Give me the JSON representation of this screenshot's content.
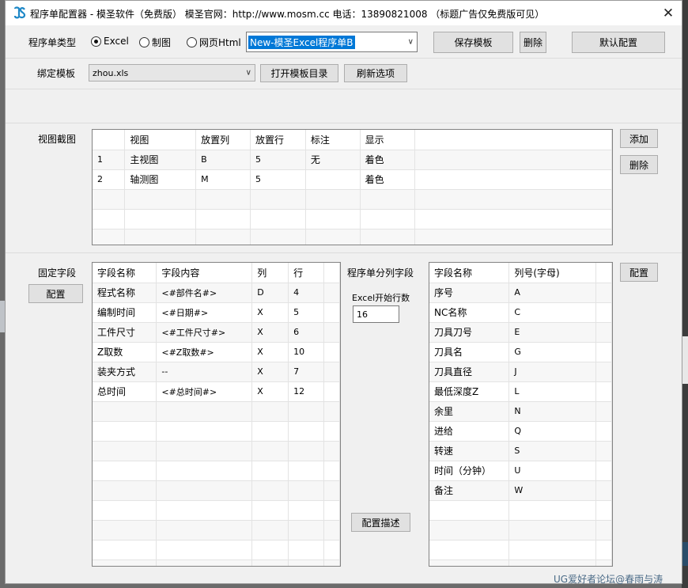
{
  "window": {
    "title": "程序单配置器 - 模圣软件（免费版） 模圣官网：http://www.mosm.cc 电话：13890821008 （标题广告仅免费版可见）",
    "close_glyph": "✕"
  },
  "program_type": {
    "label": "程序单类型",
    "options": [
      {
        "label": "Excel",
        "selected": true
      },
      {
        "label": "制图",
        "selected": false
      },
      {
        "label": "网页Html",
        "selected": false
      }
    ],
    "combo_value": "New-模圣Excel程序单B",
    "save_button": "保存模板",
    "delete_button": "删除",
    "default_button": "默认配置"
  },
  "bind_template": {
    "label": "绑定模板",
    "combo_value": "zhou.xls",
    "open_dir_button": "打开模板目录",
    "refresh_button": "刷新选项"
  },
  "view_capture": {
    "label": "视图截图",
    "headers": [
      "",
      "视图",
      "放置列",
      "放置行",
      "标注",
      "显示"
    ],
    "rows": [
      [
        "1",
        "主视图",
        "B",
        "5",
        "无",
        "着色"
      ],
      [
        "2",
        "轴测图",
        "M",
        "5",
        "",
        "着色"
      ]
    ],
    "add_button": "添加",
    "delete_button": "删除"
  },
  "fixed_fields": {
    "label": "固定字段",
    "config_button": "配置",
    "headers": [
      "字段名称",
      "字段内容",
      "列",
      "行"
    ],
    "rows": [
      [
        "程式名称",
        "<#部件名#>",
        "D",
        "4"
      ],
      [
        "编制时间",
        "<#日期#>",
        "X",
        "5"
      ],
      [
        "工件尺寸",
        "<#工件尺寸#>",
        "X",
        "6"
      ],
      [
        "Z取数",
        "<#Z取数#>",
        "X",
        "10"
      ],
      [
        "装夹方式",
        "--",
        "X",
        "7"
      ],
      [
        "总时间",
        "<#总时间#>",
        "X",
        "12"
      ]
    ]
  },
  "column_fields": {
    "label": "程序单分列字段",
    "start_row_label": "Excel开始行数",
    "start_row_value": "16",
    "describe_button": "配置描述",
    "config_button": "配置",
    "headers": [
      "字段名称",
      "列号(字母)"
    ],
    "rows": [
      [
        "序号",
        "A"
      ],
      [
        "NC名称",
        "C"
      ],
      [
        "刀具刀号",
        "E"
      ],
      [
        "刀具名",
        "G"
      ],
      [
        "刀具直径",
        "J"
      ],
      [
        "最低深度Z",
        "L"
      ],
      [
        "余里",
        "N"
      ],
      [
        "进给",
        "Q"
      ],
      [
        "转速",
        "S"
      ],
      [
        "时间（分钟）",
        "U"
      ],
      [
        "备注",
        "W"
      ]
    ]
  },
  "watermark": "UG爱好者论坛@春雨与涛"
}
